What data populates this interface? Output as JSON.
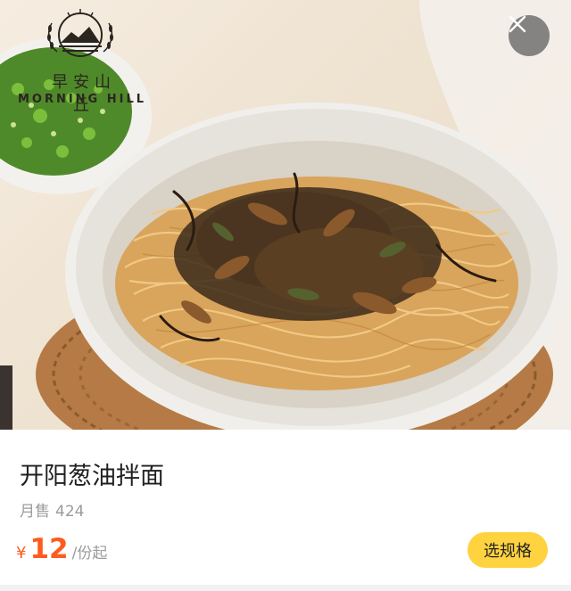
{
  "brand": {
    "name_cn": "早安山丘",
    "name_en": "MORNING HILL"
  },
  "hero": {
    "image_description_icon": "noodle-bowl-image",
    "close_icon": "close-icon"
  },
  "product": {
    "title": "开阳葱油拌面",
    "sales_label": "月售",
    "sales_count": "424",
    "currency": "¥",
    "price": "12",
    "price_unit": "/份起",
    "spec_button_label": "选规格"
  },
  "colors": {
    "accent_price": "#ff5a1f",
    "button_yellow": "#ffd23f"
  }
}
